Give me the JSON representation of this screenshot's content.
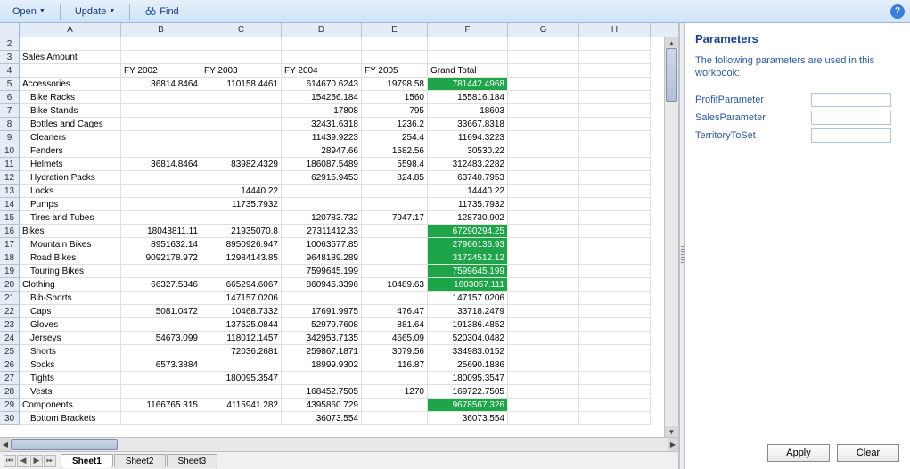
{
  "toolbar": {
    "open": "Open",
    "update": "Update",
    "find": "Find"
  },
  "columns": [
    "A",
    "B",
    "C",
    "D",
    "E",
    "F",
    "G",
    "H"
  ],
  "headerRow": {
    "b": "FY 2002",
    "c": "FY 2003",
    "d": "FY 2004",
    "e": "FY 2005",
    "f": "Grand Total"
  },
  "title": "Sales Amount",
  "rows": [
    {
      "n": 5,
      "a": "Accessories",
      "b": "36814.8464",
      "c": "110158.4461",
      "d": "614670.6243",
      "e": "19798.58",
      "f": "781442.4968",
      "hl": true
    },
    {
      "n": 6,
      "a": "Bike Racks",
      "indent": true,
      "d": "154256.184",
      "e": "1560",
      "f": "155816.184"
    },
    {
      "n": 7,
      "a": "Bike Stands",
      "indent": true,
      "d": "17808",
      "e": "795",
      "f": "18603"
    },
    {
      "n": 8,
      "a": "Bottles and Cages",
      "indent": true,
      "d": "32431.6318",
      "e": "1236.2",
      "f": "33667.8318"
    },
    {
      "n": 9,
      "a": "Cleaners",
      "indent": true,
      "d": "11439.9223",
      "e": "254.4",
      "f": "11694.3223"
    },
    {
      "n": 10,
      "a": "Fenders",
      "indent": true,
      "d": "28947.66",
      "e": "1582.56",
      "f": "30530.22"
    },
    {
      "n": 11,
      "a": "Helmets",
      "indent": true,
      "b": "36814.8464",
      "c": "83982.4329",
      "d": "186087.5489",
      "e": "5598.4",
      "f": "312483.2282"
    },
    {
      "n": 12,
      "a": "Hydration Packs",
      "indent": true,
      "d": "62915.9453",
      "e": "824.85",
      "f": "63740.7953"
    },
    {
      "n": 13,
      "a": "Locks",
      "indent": true,
      "c": "14440.22",
      "f": "14440.22"
    },
    {
      "n": 14,
      "a": "Pumps",
      "indent": true,
      "c": "11735.7932",
      "f": "11735.7932"
    },
    {
      "n": 15,
      "a": "Tires and Tubes",
      "indent": true,
      "d": "120783.732",
      "e": "7947.17",
      "f": "128730.902"
    },
    {
      "n": 16,
      "a": "Bikes",
      "b": "18043811.11",
      "c": "21935070.8",
      "d": "27311412.33",
      "f": "67290294.25",
      "hl": true
    },
    {
      "n": 17,
      "a": "Mountain Bikes",
      "indent": true,
      "b": "8951632.14",
      "c": "8950926.947",
      "d": "10063577.85",
      "f": "27966136.93",
      "hl": true
    },
    {
      "n": 18,
      "a": "Road Bikes",
      "indent": true,
      "b": "9092178.972",
      "c": "12984143.85",
      "d": "9648189.289",
      "f": "31724512.12",
      "hl": true
    },
    {
      "n": 19,
      "a": "Touring Bikes",
      "indent": true,
      "d": "7599645.199",
      "f": "7599645.199",
      "hl": true
    },
    {
      "n": 20,
      "a": "Clothing",
      "b": "66327.5346",
      "c": "665294.6067",
      "d": "860945.3396",
      "e": "10489.63",
      "f": "1603057.111",
      "hl": true
    },
    {
      "n": 21,
      "a": "Bib-Shorts",
      "indent": true,
      "c": "147157.0206",
      "f": "147157.0206"
    },
    {
      "n": 22,
      "a": "Caps",
      "indent": true,
      "b": "5081.0472",
      "c": "10468.7332",
      "d": "17691.9975",
      "e": "476.47",
      "f": "33718.2479"
    },
    {
      "n": 23,
      "a": "Gloves",
      "indent": true,
      "c": "137525.0844",
      "d": "52979.7608",
      "e": "881.64",
      "f": "191386.4852"
    },
    {
      "n": 24,
      "a": "Jerseys",
      "indent": true,
      "b": "54673.099",
      "c": "118012.1457",
      "d": "342953.7135",
      "e": "4665.09",
      "f": "520304.0482"
    },
    {
      "n": 25,
      "a": "Shorts",
      "indent": true,
      "c": "72036.2681",
      "d": "259867.1871",
      "e": "3079.56",
      "f": "334983.0152"
    },
    {
      "n": 26,
      "a": "Socks",
      "indent": true,
      "b": "6573.3884",
      "d": "18999.9302",
      "e": "116.87",
      "f": "25690.1886"
    },
    {
      "n": 27,
      "a": "Tights",
      "indent": true,
      "c": "180095.3547",
      "f": "180095.3547"
    },
    {
      "n": 28,
      "a": "Vests",
      "indent": true,
      "d": "168452.7505",
      "e": "1270",
      "f": "169722.7505"
    },
    {
      "n": 29,
      "a": "Components",
      "b": "1166765.315",
      "c": "4115941.282",
      "d": "4395860.729",
      "f": "9678567.326",
      "hl": true
    },
    {
      "n": 30,
      "a": "Bottom Brackets",
      "indent": true,
      "d": "36073.554",
      "f": "36073.554"
    }
  ],
  "tabs": [
    "Sheet1",
    "Sheet2",
    "Sheet3"
  ],
  "activeTab": 0,
  "params": {
    "title": "Parameters",
    "desc": "The following parameters are used in this workbook:",
    "items": [
      {
        "label": "ProfitParameter",
        "value": ""
      },
      {
        "label": "SalesParameter",
        "value": ""
      },
      {
        "label": "TerritoryToSet",
        "value": ""
      }
    ],
    "apply": "Apply",
    "clear": "Clear"
  }
}
